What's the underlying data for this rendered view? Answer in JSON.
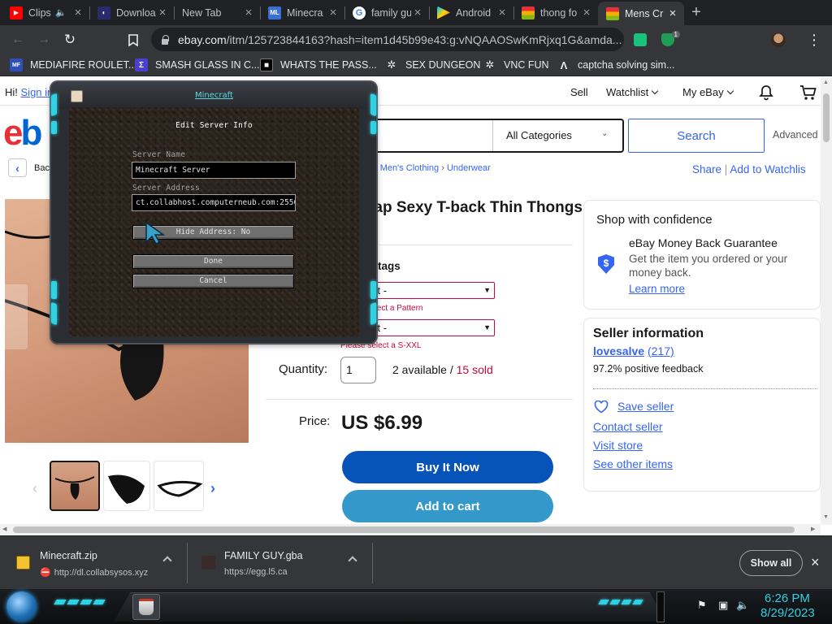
{
  "browser": {
    "tabs": [
      {
        "title": "Clips",
        "icon": "youtube-icon",
        "color": "#ff0000"
      },
      {
        "title": "Downloa",
        "icon": "download-site-icon",
        "color": "#5b4bd6"
      },
      {
        "title": "New Tab",
        "icon": "",
        "color": ""
      },
      {
        "title": "Minecra",
        "icon": "ml-icon",
        "color": "#3b6fd1",
        "icon_text": "ML"
      },
      {
        "title": "family gu",
        "icon": "google-icon",
        "color": "#4285f4"
      },
      {
        "title": "Android",
        "icon": "play-store-icon",
        "color": "#01875f"
      },
      {
        "title": "thong fo",
        "icon": "rainbow-icon",
        "color": "#d94f3d"
      },
      {
        "title": "Mens Cr",
        "icon": "rainbow-icon",
        "color": "#d94f3d"
      }
    ],
    "url_domain": "ebay.com",
    "url_rest": "/itm/125723844163?hash=item1d45b99e43:g:vNQAAOSwKmRjxq1G&amda...",
    "extension_badge": "1"
  },
  "bookmarks": [
    {
      "label": "MEDIAFIRE ROULET...",
      "icon": "mediafire-icon",
      "icon_text": "MF"
    },
    {
      "label": "SMASH GLASS IN C...",
      "icon": "bracket-icon",
      "icon_text": "Σ"
    },
    {
      "label": "WHATS THE PASS...",
      "icon": "black-square-icon",
      "icon_text": "■"
    },
    {
      "label": "SEX DUNGEON",
      "icon": "gear-icon",
      "icon_text": "✲"
    },
    {
      "label": "VNC FUN",
      "icon": "gear-icon",
      "icon_text": "✲"
    },
    {
      "label": "captcha solving sim...",
      "icon": "a-icon",
      "icon_text": "Λ"
    }
  ],
  "ebay": {
    "greeting": "Hi!",
    "sign_in": "Sign in",
    "nav": {
      "sell": "Sell",
      "watchlist": "Watchlist",
      "my_ebay": "My eBay"
    },
    "logo": "eb",
    "category": "All Categories",
    "search_button": "Search",
    "advanced": "Advanced",
    "back": "Back",
    "breadcrumb": [
      "Men's Clothing",
      "Underwear"
    ],
    "share": "Share",
    "add_watchlist": "Add to Watchlis",
    "title": "rap Sexy T-back Thin Thongs",
    "tags_label": "n tags",
    "select1": "ct -",
    "select1_error": "elect a Pattern",
    "select2": "ct -",
    "select2_error": "Please select a S-XXL",
    "quantity_label": "Quantity:",
    "quantity_value": "1",
    "available": "2 available / ",
    "sold": "15 sold",
    "price_label": "Price:",
    "price": "US $6.99",
    "buy_now": "Buy It Now",
    "add_cart": "Add to cart",
    "confidence": {
      "heading": "Shop with confidence",
      "guarantee": "eBay Money Back Guarantee",
      "desc1": "Get the item you ordered or your",
      "desc2": "money back.",
      "learn": "Learn more"
    },
    "seller": {
      "heading": "Seller information",
      "name": "lovesalve",
      "count": "(217)",
      "feedback": "97.2% positive feedback",
      "save": "Save seller",
      "contact": "Contact seller",
      "store": "Visit store",
      "other": "See other items"
    }
  },
  "minecraft": {
    "window_title": "Minecraft",
    "heading": "Edit Server Info",
    "name_label": "Server Name",
    "name_value": "Minecraft Server",
    "address_label": "Server Address",
    "address_value": "ct.collabhost.computerneub.com:25566",
    "hide_address": "Hide Address: No",
    "done": "Done",
    "cancel": "Cancel"
  },
  "downloads": {
    "items": [
      {
        "name": "Minecraft.zip",
        "source": "http://dl.collabsysos.xyz"
      },
      {
        "name": "FAMILY GUY.gba",
        "source": "https://egg.l5.ca"
      }
    ],
    "show_all": "Show all"
  },
  "taskbar": {
    "time": "6:26 PM",
    "date": "8/29/2023"
  }
}
